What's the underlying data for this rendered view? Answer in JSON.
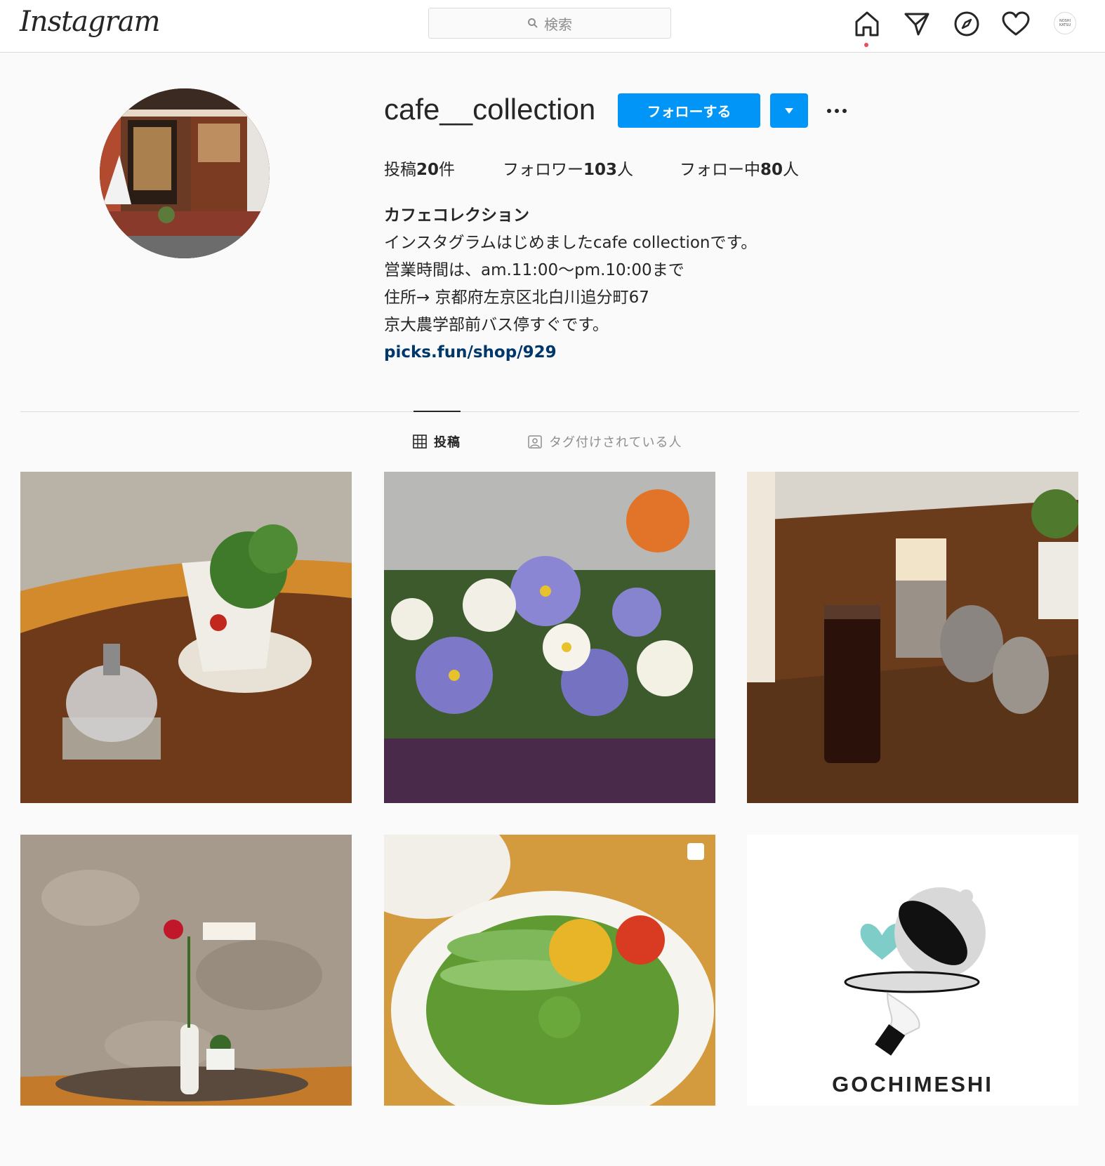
{
  "header": {
    "logo_text": "Instagram",
    "search_placeholder": "検索",
    "nav_icons": [
      "home-icon",
      "direct-message-icon",
      "explore-icon",
      "activity-heart-icon",
      "profile-avatar-icon"
    ],
    "mini_avatar_text": "NOSHI KATSU"
  },
  "profile": {
    "username": "cafe__collection",
    "follow_label": "フォローする",
    "stats": [
      {
        "label": "投稿",
        "count": "20",
        "suffix": "件"
      },
      {
        "label": "フォロワー",
        "count": "103",
        "suffix": "人"
      },
      {
        "label": "フォロー中",
        "count": "80",
        "suffix": "人"
      }
    ],
    "display_name": "カフェコレクション",
    "bio_lines": [
      "インスタグラムはじめましたcafe collectionです。",
      "営業時間は、am.11:00〜pm.10:00まで",
      "住所→ 京都府左京区北白川追分町67",
      "京大農学部前バス停すぐです。"
    ],
    "link": "picks.fun/shop/929"
  },
  "tabs": [
    {
      "label": "投稿",
      "icon": "grid-icon",
      "active": true
    },
    {
      "label": "タグ付けされている人",
      "icon": "tagged-person-icon",
      "active": false
    }
  ],
  "posts": [
    {
      "subject": "strawberry-plant-on-table"
    },
    {
      "subject": "pansy-flowers"
    },
    {
      "subject": "iced-coffee"
    },
    {
      "subject": "rose-vase-wall"
    },
    {
      "subject": "salad-plate"
    },
    {
      "subject": "gochimeshi-logo",
      "text": "GOCHIMESHI"
    }
  ],
  "colors": {
    "accent": "#0095f6",
    "link": "#00376b",
    "notification_dot": "#ed4956",
    "logo_heart": "#7ecdc8"
  }
}
